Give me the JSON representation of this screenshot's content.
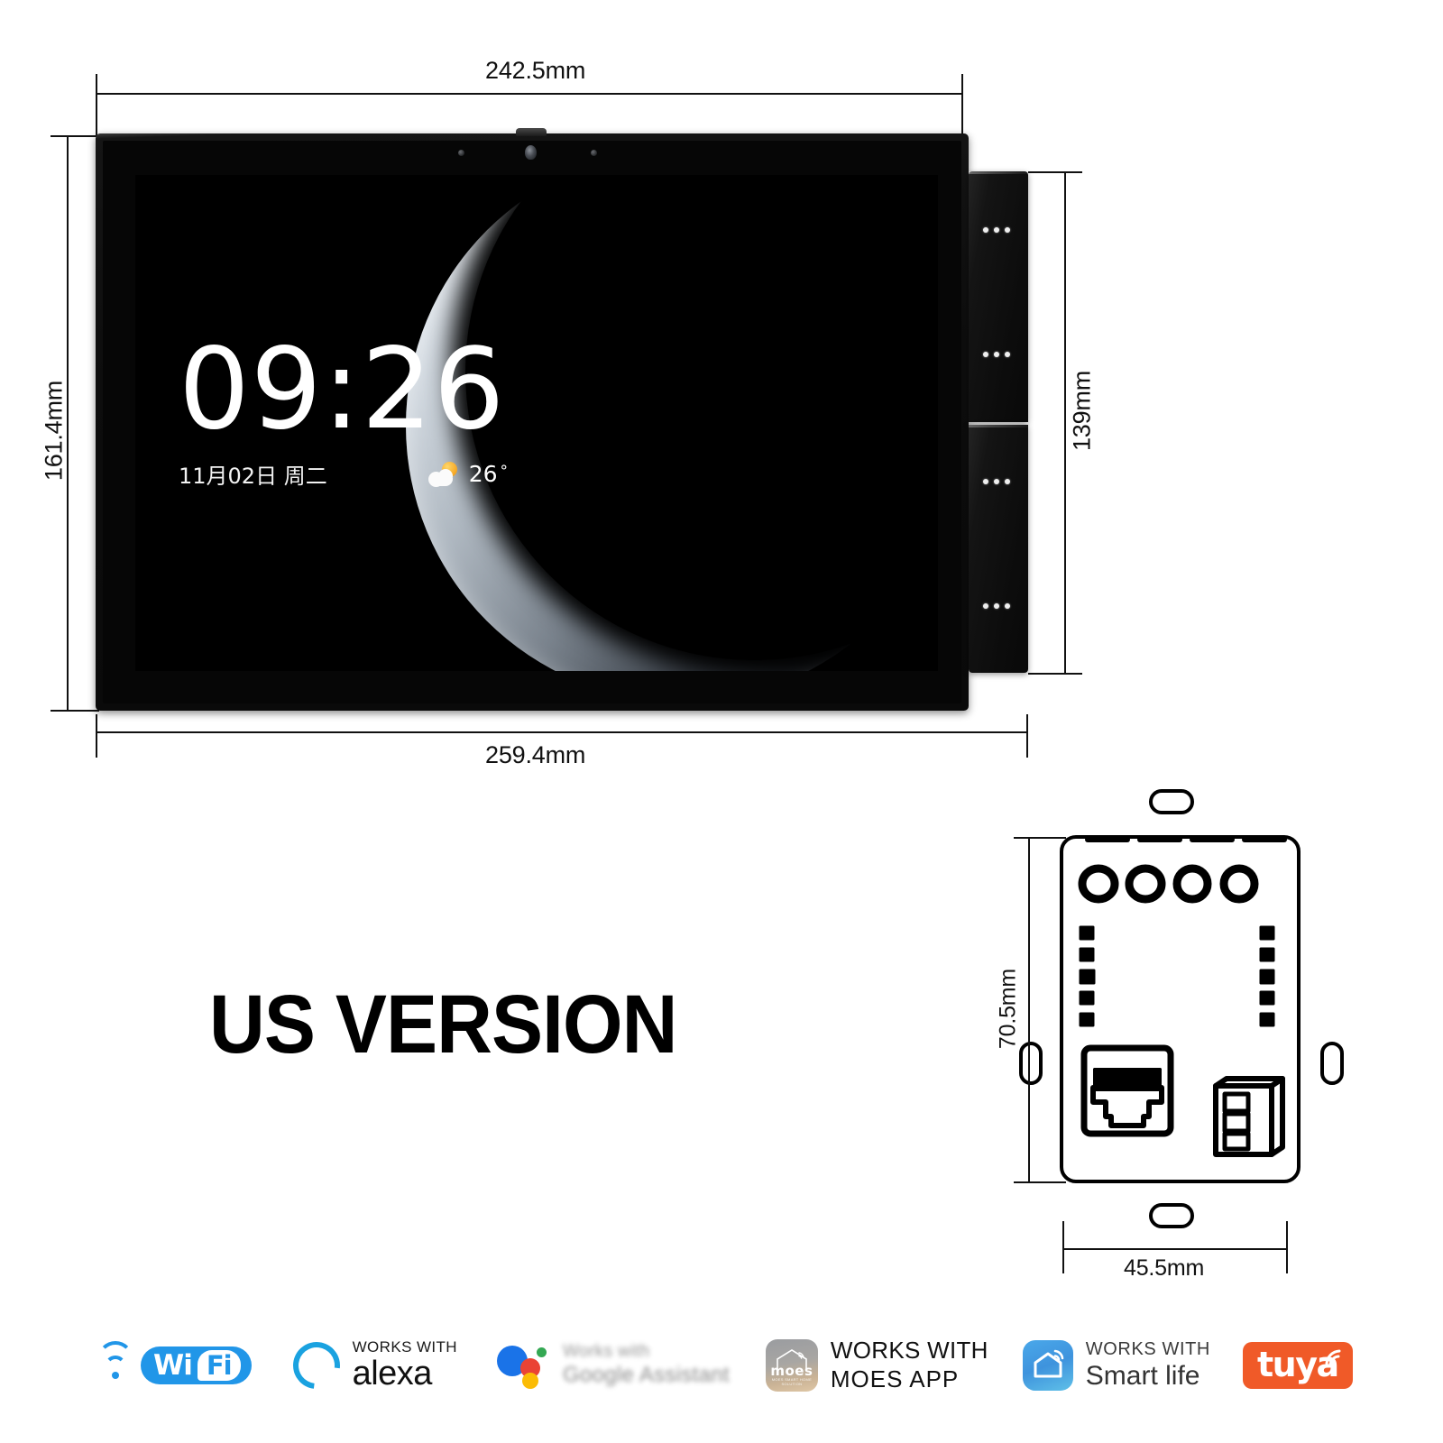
{
  "product": {
    "version_label": "US VERSION"
  },
  "dimensions": {
    "front_width_screen": "242.5mm",
    "front_height_screen": "161.4mm",
    "front_width_total": "259.4mm",
    "side_module_height": "139mm",
    "back_height": "70.5mm",
    "back_width": "45.5mm"
  },
  "screen": {
    "time": "09:26",
    "date": "11月02日  周二",
    "temperature": "26",
    "degree_symbol": "°",
    "weather_icon": "partly-cloudy-icon",
    "wallpaper": "crescent-moon"
  },
  "side_panel": {
    "modules": [
      {
        "indicator": "three-dots"
      },
      {
        "indicator": "three-dots"
      },
      {
        "indicator": "three-dots"
      },
      {
        "indicator": "three-dots"
      }
    ]
  },
  "back_panel": {
    "screw_holes": 4,
    "left_vents": 5,
    "right_vents": 5,
    "ports": [
      "rj45-ethernet-port",
      "terminal-block-3pin"
    ],
    "mounting_slots": 4
  },
  "badges": [
    {
      "id": "wifi",
      "icon": "wifi-icon",
      "wi": "Wi",
      "fi": "Fi"
    },
    {
      "id": "alexa",
      "icon": "alexa-ring-icon",
      "line1": "WORKS WITH",
      "line2": "alexa"
    },
    {
      "id": "google-assistant",
      "icon": "google-assistant-dots-icon",
      "line1": "Works with",
      "line2": "Google Assistant"
    },
    {
      "id": "moes-app",
      "icon": "moes-app-icon",
      "icon_word": "moes",
      "icon_tagline": "MOES SMART HOME SOLUTION",
      "line1": "WORKS WITH",
      "line2": "MOES APP"
    },
    {
      "id": "smart-life",
      "icon": "smart-life-house-icon",
      "line1": "WORKS WITH",
      "line2": "Smart life"
    },
    {
      "id": "tuya",
      "icon": "tuya-icon",
      "word": "tuya"
    }
  ]
}
